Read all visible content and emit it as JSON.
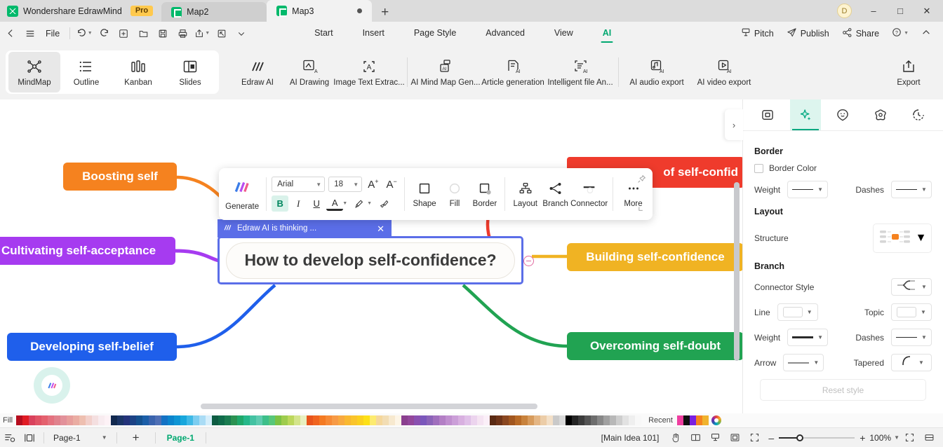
{
  "titlebar": {
    "brand": "Wondershare EdrawMind",
    "pro_badge": "Pro",
    "tabs": [
      {
        "label": "Map2",
        "active": false
      },
      {
        "label": "Map3",
        "active": true
      }
    ],
    "new_tab": "+",
    "avatar_initial": "D",
    "minimize": "–",
    "maximize": "□",
    "close": "✕"
  },
  "menubar": {
    "file_label": "File",
    "items": [
      {
        "label": "Start",
        "selected": false
      },
      {
        "label": "Insert",
        "selected": false
      },
      {
        "label": "Page Style",
        "selected": false
      },
      {
        "label": "Advanced",
        "selected": false
      },
      {
        "label": "View",
        "selected": false
      },
      {
        "label": "AI",
        "selected": true
      }
    ],
    "right_items": [
      {
        "label": "Pitch",
        "icon": "pitch-icon"
      },
      {
        "label": "Publish",
        "icon": "publish-icon"
      },
      {
        "label": "Share",
        "icon": "share-icon"
      }
    ],
    "help_label": "?",
    "collapse_label": "^"
  },
  "ribbon": {
    "view_group": [
      {
        "label": "MindMap",
        "icon": "mindmap-icon",
        "active": true
      },
      {
        "label": "Outline",
        "icon": "outline-icon",
        "active": false
      },
      {
        "label": "Kanban",
        "icon": "kanban-icon",
        "active": false
      },
      {
        "label": "Slides",
        "icon": "slides-icon",
        "active": false
      }
    ],
    "ai_group_1": [
      {
        "label": "Edraw AI",
        "icon": "edraw-ai-icon"
      },
      {
        "label": "AI Drawing",
        "icon": "ai-drawing-icon"
      },
      {
        "label": "Image Text Extrac...",
        "icon": "image-text-extract-icon"
      }
    ],
    "ai_group_2": [
      {
        "label": "AI Mind Map Gen...",
        "icon": "ai-mindmap-gen-icon"
      },
      {
        "label": "Article generation",
        "icon": "article-generation-icon"
      },
      {
        "label": "Intelligent file An...",
        "icon": "intelligent-file-analysis-icon"
      }
    ],
    "ai_group_3": [
      {
        "label": "AI audio export",
        "icon": "ai-audio-export-icon"
      },
      {
        "label": "AI video export",
        "icon": "ai-video-export-icon"
      }
    ],
    "export": {
      "label": "Export",
      "icon": "export-icon"
    }
  },
  "canvas": {
    "central_topic": "How to develop self-confidence?",
    "thinking_text": "Edraw AI is thinking  ...",
    "thinking_close": "✕",
    "nodes": [
      {
        "text": "Boosting self",
        "color": "#f5821f",
        "name": "node-boosting-self"
      },
      {
        "text": "Cultivating self-acceptance",
        "color": "#a63bf0",
        "name": "node-cultivating-self-acceptance"
      },
      {
        "text": "Developing self-belief",
        "color": "#1f5feb",
        "name": "node-developing-self-belief"
      },
      {
        "text": "of self-confid",
        "color": "#ef3b2c",
        "name": "node-self-confidence-red"
      },
      {
        "text": "Building self-confidence",
        "color": "#f0b323",
        "name": "node-building-self-confidence"
      },
      {
        "text": "Overcoming self-doubt",
        "color": "#21a352",
        "name": "node-overcoming-self-doubt"
      }
    ]
  },
  "format_toolbar": {
    "generate_label": "Generate",
    "font_family": "Arial",
    "font_size": "18",
    "increase_size": "A",
    "decrease_size": "A",
    "bold": "B",
    "italic": "I",
    "underline": "U",
    "font_color": "A",
    "highlight": "✎",
    "format_painter": "✄",
    "tools": [
      {
        "label": "Shape",
        "icon": "shape-icon"
      },
      {
        "label": "Fill",
        "icon": "fill-icon"
      },
      {
        "label": "Border",
        "icon": "border-icon"
      },
      {
        "label": "Layout",
        "icon": "layout-icon"
      },
      {
        "label": "Branch",
        "icon": "branch-icon"
      },
      {
        "label": "Connector",
        "icon": "connector-icon"
      },
      {
        "label": "More",
        "icon": "more-icon"
      }
    ]
  },
  "right_panel": {
    "toggle_icon": "›",
    "tabs": [
      {
        "name": "shape-style-tab",
        "icon": "square-in-square-icon",
        "active": false
      },
      {
        "name": "ai-style-tab",
        "icon": "sparkle-icon",
        "active": true
      },
      {
        "name": "emoji-tab",
        "icon": "smiley-icon",
        "active": false
      },
      {
        "name": "sticker-tab",
        "icon": "flower-icon",
        "active": false
      },
      {
        "name": "history-tab",
        "icon": "clock-icon",
        "active": false
      }
    ],
    "border": {
      "title": "Border",
      "border_color_label": "Border Color",
      "weight_label": "Weight",
      "dashes_label": "Dashes"
    },
    "layout": {
      "title": "Layout",
      "structure_label": "Structure"
    },
    "branch": {
      "title": "Branch",
      "connector_style_label": "Connector Style",
      "line_label": "Line",
      "topic_label": "Topic",
      "weight_label": "Weight",
      "dashes_label": "Dashes",
      "arrow_label": "Arrow",
      "tapered_label": "Tapered"
    },
    "reset_button": "Reset style"
  },
  "color_strip": {
    "fill_label": "Fill",
    "recent_label": "Recent",
    "colors": [
      "#b50d1e",
      "#e01b24",
      "#d9415c",
      "#e05365",
      "#e4616e",
      "#e4727f",
      "#e0828d",
      "#e2919a",
      "#e79e9c",
      "#eaada3",
      "#eebfb0",
      "#f2d0cb",
      "#f4dfe0",
      "#f8ecf0",
      "#fdf2f6",
      "#12294f",
      "#1b3566",
      "#24337a",
      "#1c4285",
      "#14518f",
      "#1b5ea8",
      "#3a63ad",
      "#4f6fb5",
      "#1372c4",
      "#0b84cc",
      "#0e95d4",
      "#18a7dc",
      "#3fb9e6",
      "#7ccdf0",
      "#aadcf5",
      "#d5eefb",
      "#0d5c42",
      "#0f6b4a",
      "#1a7c50",
      "#2b9252",
      "#1fa86a",
      "#26b88a",
      "#44c2a2",
      "#5fcbb0",
      "#3dbf8a",
      "#57c77a",
      "#7cc244",
      "#9ecc4d",
      "#bcd75c",
      "#d4e48b",
      "#e8f0c0",
      "#e8541c",
      "#f0641f",
      "#f47a22",
      "#f68a35",
      "#f79a45",
      "#f8a93f",
      "#f9b830",
      "#fac42b",
      "#fbd01f",
      "#fde017",
      "#fdeb6f",
      "#f5d79b",
      "#f2ddb4",
      "#f7e9cf",
      "#fdf5e6",
      "#8a3f8f",
      "#93479b",
      "#8a50b0",
      "#7b57bb",
      "#8b63b8",
      "#a06fbd",
      "#b37fc5",
      "#c08fcf",
      "#cb9fd8",
      "#d8b0e0",
      "#e0c0e8",
      "#ecd4ee",
      "#f5e4f2",
      "#fbeff8",
      "#5a2a13",
      "#6e3418",
      "#8a4720",
      "#a1561f",
      "#b86a26",
      "#c8823c",
      "#d79b5c",
      "#e4b684",
      "#eccda8",
      "#f3e0c8",
      "#c9c9c9",
      "#d8d8d8",
      "#000000",
      "#242424",
      "#3b3b3b",
      "#545454",
      "#6d6d6d",
      "#878787",
      "#a0a0a0",
      "#b8b8b8",
      "#cecece",
      "#e2e2e2",
      "#efefef",
      "#f8f8f8"
    ],
    "recent_colors": [
      "#ef3ea0",
      "#111111",
      "#7a1fe0",
      "#f5821f",
      "#f0b32e"
    ],
    "wheel_icon": "color-wheel-icon"
  },
  "statusbar": {
    "page_select_value": "Page-1",
    "add_page": "+",
    "page_name": "Page-1",
    "main_idea": "[Main Idea 101]",
    "zoom_minus": "–",
    "zoom_plus": "+",
    "zoom_level": "100%"
  }
}
